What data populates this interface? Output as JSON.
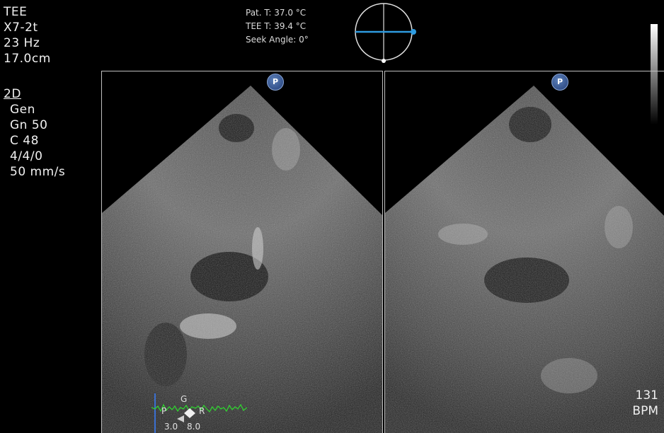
{
  "probe": {
    "lines": [
      "TEE",
      "X7-2t",
      "23 Hz",
      "17.0cm"
    ]
  },
  "mode": {
    "title": "2D",
    "lines": [
      "Gen",
      "Gn 50",
      "C 48",
      "4/4/0",
      "50 mm/s"
    ]
  },
  "temperature": {
    "patient": "Pat. T: 37.0 °C",
    "tee": "TEE T: 39.4 °C",
    "seek_angle": "Seek Angle: 0°"
  },
  "orientation_indicator": {
    "left_label": "P",
    "right_label": "P",
    "accent_color": "#2e9be0"
  },
  "heart_rate": {
    "value": "131",
    "unit": "BPM"
  },
  "ecg": {
    "top_label": "G",
    "left_label": "P",
    "right_label": "R",
    "scale_left": "3.0",
    "scale_right": "8.0",
    "trace_color": "#2fd12f"
  }
}
